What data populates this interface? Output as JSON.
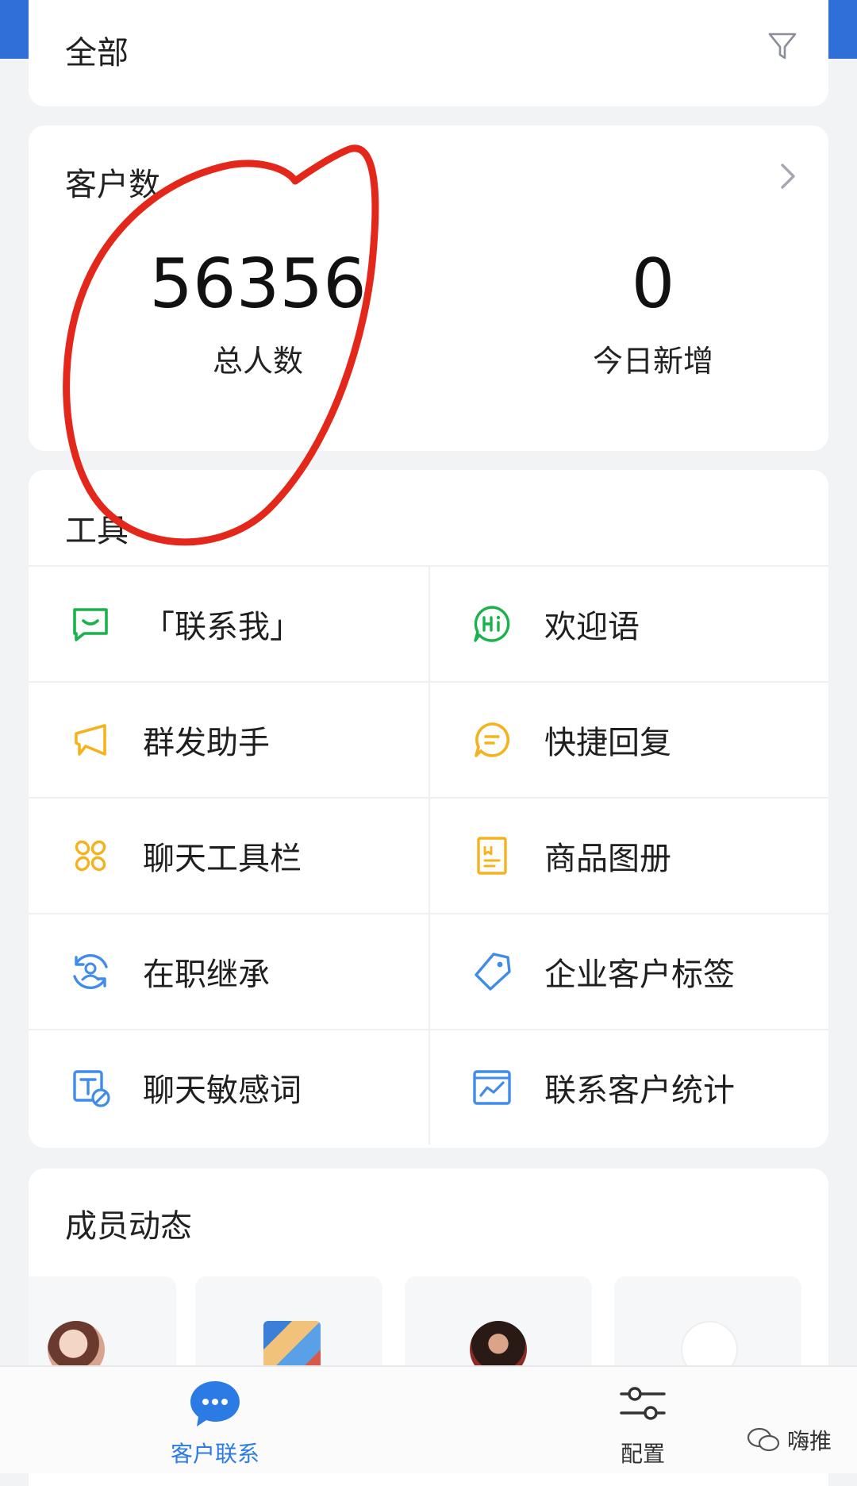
{
  "filter": {
    "label": "全部",
    "icon": "filter-icon"
  },
  "stats": {
    "title": "客户数",
    "total": {
      "value": "56356",
      "label": "总人数"
    },
    "today": {
      "value": "0",
      "label": "今日新增"
    }
  },
  "tools": {
    "title": "工具",
    "items": [
      {
        "label": "「联系我」",
        "icon": "contact-me-icon",
        "color": "#19b24b"
      },
      {
        "label": "欢迎语",
        "icon": "hi-greeting-icon",
        "color": "#19b24b"
      },
      {
        "label": "群发助手",
        "icon": "megaphone-icon",
        "color": "#f5b21d"
      },
      {
        "label": "快捷回复",
        "icon": "quick-reply-icon",
        "color": "#f5b21d"
      },
      {
        "label": "聊天工具栏",
        "icon": "chat-toolbar-icon",
        "color": "#f5b21d"
      },
      {
        "label": "商品图册",
        "icon": "product-album-icon",
        "color": "#f5b21d"
      },
      {
        "label": "在职继承",
        "icon": "succession-icon",
        "color": "#3f8ce9"
      },
      {
        "label": "企业客户标签",
        "icon": "tag-icon",
        "color": "#3f8ce9"
      },
      {
        "label": "聊天敏感词",
        "icon": "sensitive-word-icon",
        "color": "#3f8ce9"
      },
      {
        "label": "联系客户统计",
        "icon": "statistics-icon",
        "color": "#3f8ce9"
      }
    ]
  },
  "members": {
    "title": "成员动态"
  },
  "tabbar": {
    "customer": {
      "label": "客户联系",
      "icon": "chat-bubble-icon",
      "active": true
    },
    "config": {
      "label": "配置",
      "icon": "settings-sliders-icon",
      "active": false
    }
  },
  "watermark": {
    "text": "嗨推"
  },
  "colors": {
    "accent": "#2c7be5",
    "annotation": "#e3281b",
    "edge": "#2f6fd8"
  }
}
